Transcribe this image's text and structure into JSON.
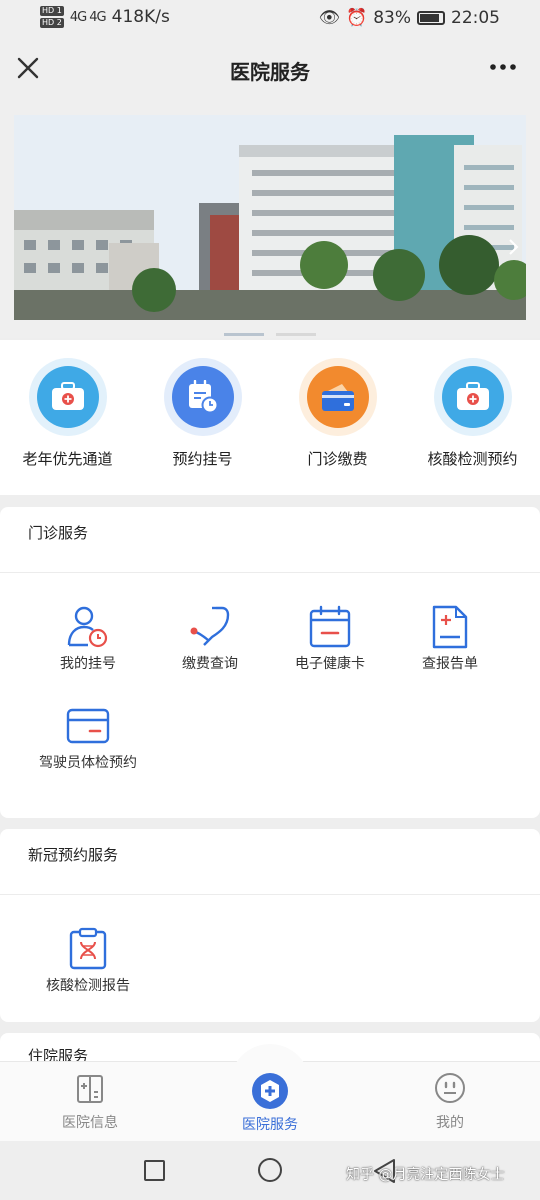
{
  "status_bar": {
    "hd1": "HD 1",
    "hd2": "HD 2",
    "signal": "4G 4G",
    "speed": "418K/s",
    "battery": "83%",
    "time": "22:05"
  },
  "header": {
    "title": "医院服务"
  },
  "quick_actions": [
    {
      "label": "老年优先通道",
      "icon": "medical-kit-icon",
      "color": "#3fa9e6"
    },
    {
      "label": "预约挂号",
      "icon": "calendar-clock-icon",
      "color": "#4a83e8"
    },
    {
      "label": "门诊缴费",
      "icon": "wallet-card-icon",
      "color": "#f28a2e"
    },
    {
      "label": "核酸检测预约",
      "icon": "medical-kit-icon",
      "color": "#3fa9e6"
    }
  ],
  "outpatient": {
    "title": "门诊服务",
    "items": [
      {
        "label": "我的挂号",
        "icon": "user-clock-icon"
      },
      {
        "label": "缴费查询",
        "icon": "stethoscope-icon"
      },
      {
        "label": "电子健康卡",
        "icon": "calendar-minus-icon"
      },
      {
        "label": "查报告单",
        "icon": "report-doc-icon"
      },
      {
        "label": "驾驶员体检预约",
        "icon": "card-icon"
      }
    ]
  },
  "covid": {
    "title": "新冠预约服务",
    "items": [
      {
        "label": "核酸检测报告",
        "icon": "dna-clipboard-icon"
      }
    ]
  },
  "inpatient": {
    "title": "住院服务"
  },
  "tabbar": {
    "tabs": [
      {
        "label": "医院信息",
        "icon": "hospital-building-icon"
      },
      {
        "label": "医院服务",
        "icon": "medical-cross-icon"
      },
      {
        "label": "我的",
        "icon": "face-icon"
      }
    ]
  },
  "watermark": "知乎 @月亮注定西陈女士",
  "colors": {
    "accent": "#3a6fd8",
    "icon_blue": "#2f6fdc",
    "icon_red": "#e8504a"
  }
}
